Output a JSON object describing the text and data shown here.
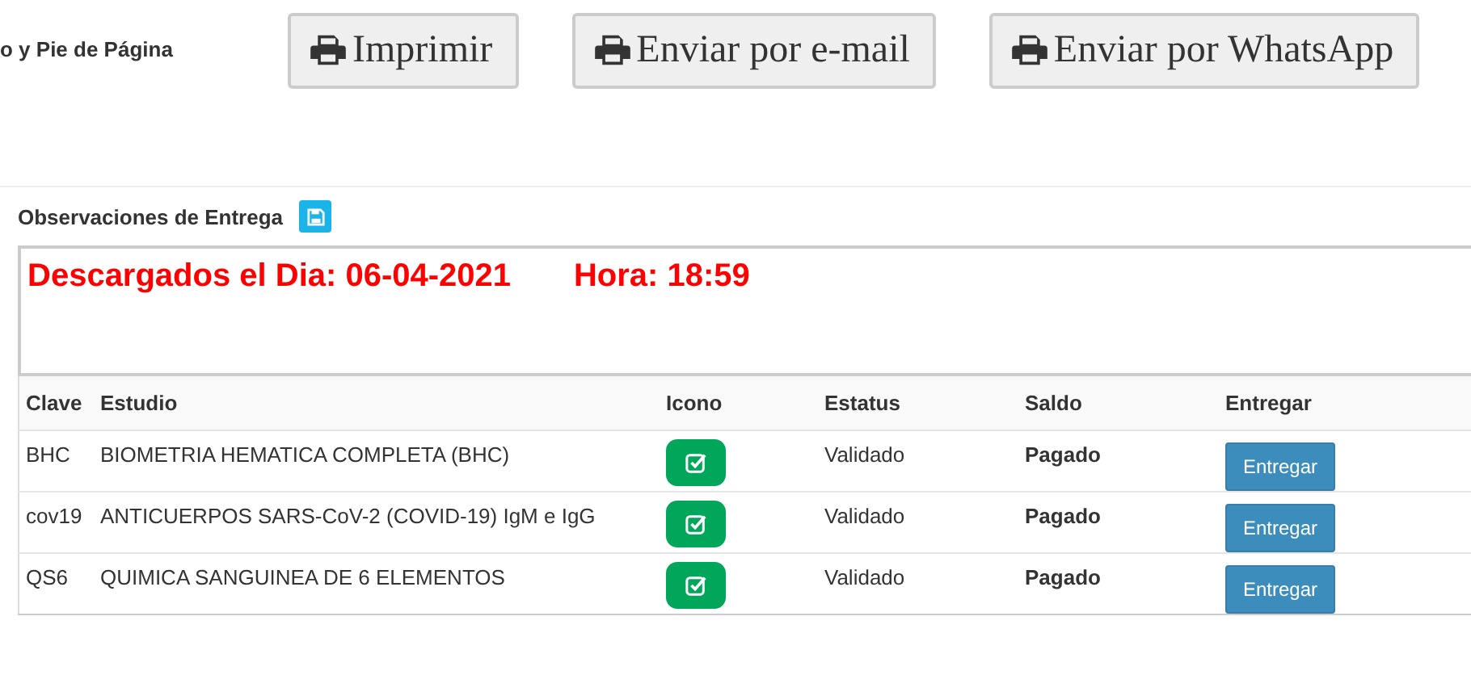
{
  "header": {
    "label": "o y Pie de Página"
  },
  "actions": [
    {
      "label": "Imprimir"
    },
    {
      "label": "Enviar por e-mail"
    },
    {
      "label": "Enviar por WhatsApp"
    }
  ],
  "observations": {
    "label": "Observaciones de Entrega",
    "value": "Descargados el Dia: 06-04-2021       Hora: 18:59"
  },
  "table": {
    "columns": [
      "Clave",
      "Estudio",
      "Icono",
      "Estatus",
      "Saldo",
      "Entregar"
    ],
    "rows": [
      {
        "clave": "BHC",
        "estudio": "BIOMETRIA HEMATICA COMPLETA (BHC)",
        "validated": true,
        "estatus": "Validado",
        "saldo": "Pagado",
        "action": "Entregar"
      },
      {
        "clave": "cov19",
        "estudio": "ANTICUERPOS SARS-CoV-2 (COVID-19) IgM e IgG",
        "validated": true,
        "estatus": "Validado",
        "saldo": "Pagado",
        "action": "Entregar"
      },
      {
        "clave": "QS6",
        "estudio": "QUIMICA SANGUINEA DE 6 ELEMENTOS",
        "validated": true,
        "estatus": "Validado",
        "saldo": "Pagado",
        "action": "Entregar"
      }
    ]
  }
}
